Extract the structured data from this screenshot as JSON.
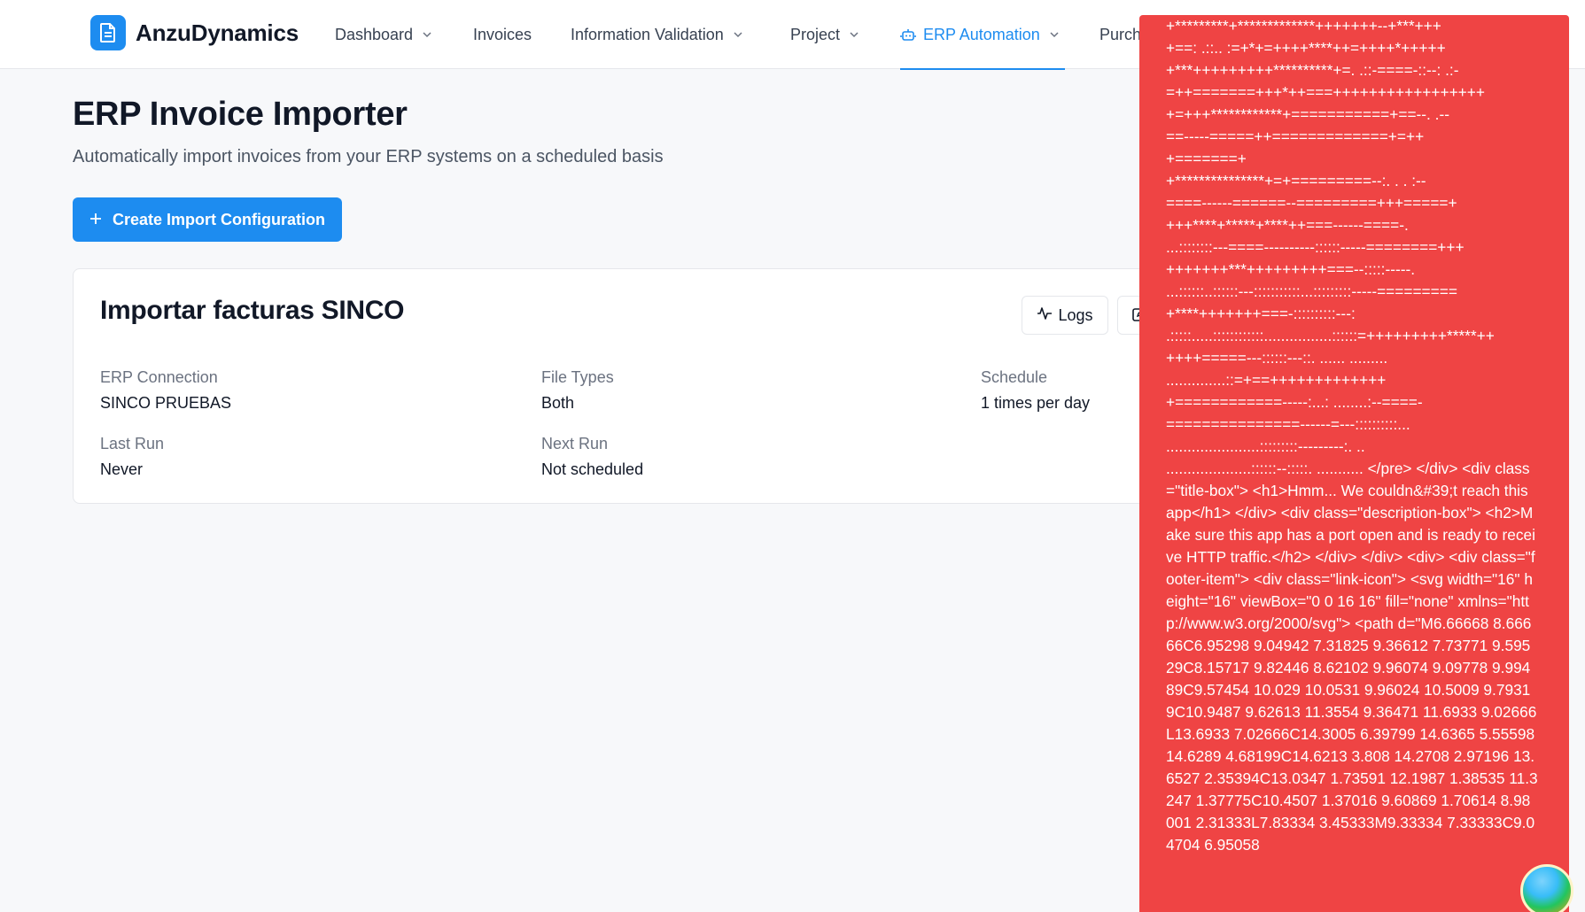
{
  "header": {
    "brand": "AnzuDynamics",
    "nav": [
      {
        "label": "Dashboard"
      },
      {
        "label": "Invoices"
      },
      {
        "label": "Information Validation"
      },
      {
        "label": "Project"
      },
      {
        "label": "ERP Automation"
      },
      {
        "label": "Purch"
      }
    ]
  },
  "page": {
    "title": "ERP Invoice Importer",
    "subtitle": "Automatically import invoices from your ERP systems on a scheduled basis",
    "create_button": "Create Import Configuration"
  },
  "card": {
    "title": "Importar facturas SINCO",
    "logs_button": "Logs",
    "fields": [
      {
        "label": "ERP Connection",
        "value": "SINCO PRUEBAS"
      },
      {
        "label": "File Types",
        "value": "Both"
      },
      {
        "label": "Schedule",
        "value": "1 times per day"
      },
      {
        "label": "Last Run",
        "value": "Never"
      },
      {
        "label": "Next Run",
        "value": "Not scheduled"
      }
    ]
  },
  "overlay": {
    "text": "+*********+*************+++++++--+***+++\n+==: .::.. :=+*+=++++****++=++++*+++++\n+***+++++++++**********+=. .::-====-::--: .:-\n=++=======+++*++===+++++++++++++++++\n+=+++************+===========+==--. .--\n==-----=====++=============+=++\n+=======+\n+***************+=+=========--:. . . :--\n====------======--=========+++=====+\n+++****+*****+****++===------====-.\n...::::::::---====----------::::::-----========+++\n+++++++***+++++++++===--:::::-----.\n...::::::..::::::---:::::::::::...:::::::::-----=========\n+****+++++++===-::::::::::---:\n.:::::.....::::::::::::................::::::=+++++++++*****++\n++++=====---::::::---::. ...... .........\n..............::=+==+++++++++++++\n+============-----:...: ........:--====-\n===============------=---::::::::::...\n......................:::::::::---------:. ..\n....................::::::--:::::. ........... </pre> </div> <div class=\"title-box\"> <h1>Hmm... We couldn&#39;t reach this app</h1> </div> <div class=\"description-box\"> <h2>Make sure this app has a port open and is ready to receive HTTP traffic.</h2> </div> </div> <div> <div class=\"footer-item\"> <div class=\"link-icon\"> <svg width=\"16\" height=\"16\" viewBox=\"0 0 16 16\" fill=\"none\" xmlns=\"http://www.w3.org/2000/svg\"> <path d=\"M6.66668 8.66666C6.95298 9.04942 7.31825 9.36612 7.73771 9.59529C8.15717 9.82446 8.62102 9.96074 9.09778 9.99489C9.57454 10.029 10.0531 9.96024 10.5009 9.79319C10.9487 9.62613 11.3554 9.36471 11.6933 9.02666L13.6933 7.02666C14.3005 6.39799 14.6365 5.55598 14.6289 4.68199C14.6213 3.808 14.2708 2.97196 13.6527 2.35394C13.0347 1.73591 12.1987 1.38535 11.3247 1.37775C10.4507 1.37016 9.60869 1.70614 8.98001 2.31333L7.83334 3.45333M9.33334 7.33333C9.04704 6.95058"
  },
  "colors": {
    "accent": "#1d8cf0",
    "overlay": "#ef4444"
  }
}
